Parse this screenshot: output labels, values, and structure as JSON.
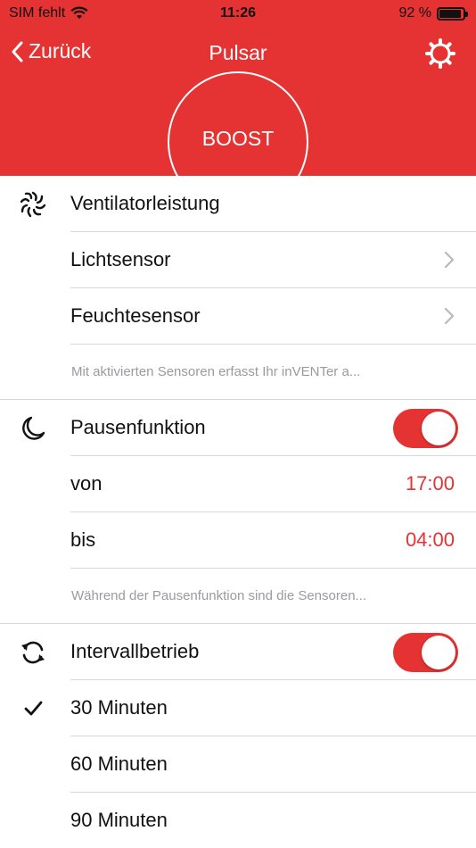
{
  "status_bar": {
    "carrier": "SIM fehlt",
    "time": "11:26",
    "battery": "92 %"
  },
  "nav": {
    "back_label": "Zurück",
    "title": "Pulsar"
  },
  "boost": {
    "label": "BOOST"
  },
  "section1": {
    "fan_label": "Ventilatorleistung",
    "light_label": "Lichtsensor",
    "humidity_label": "Feuchtesensor",
    "note": "Mit aktivierten Sensoren erfasst Ihr inVENTer  a..."
  },
  "section2": {
    "pause_label": "Pausenfunktion",
    "pause_on": true,
    "from_label": "von",
    "from_value": "17:00",
    "to_label": "bis",
    "to_value": "04:00",
    "note": "Während der Pausenfunktion sind die Sensoren..."
  },
  "section3": {
    "interval_label": "Intervallbetrieb",
    "interval_on": true,
    "options": [
      "30 Minuten",
      "60 Minuten",
      "90 Minuten"
    ],
    "selected_option": "30 Minuten"
  },
  "colors": {
    "accent": "#e53333",
    "header_bg": "#e53333",
    "separator": "#d8d8dc",
    "note_text": "#9a9aa0"
  }
}
